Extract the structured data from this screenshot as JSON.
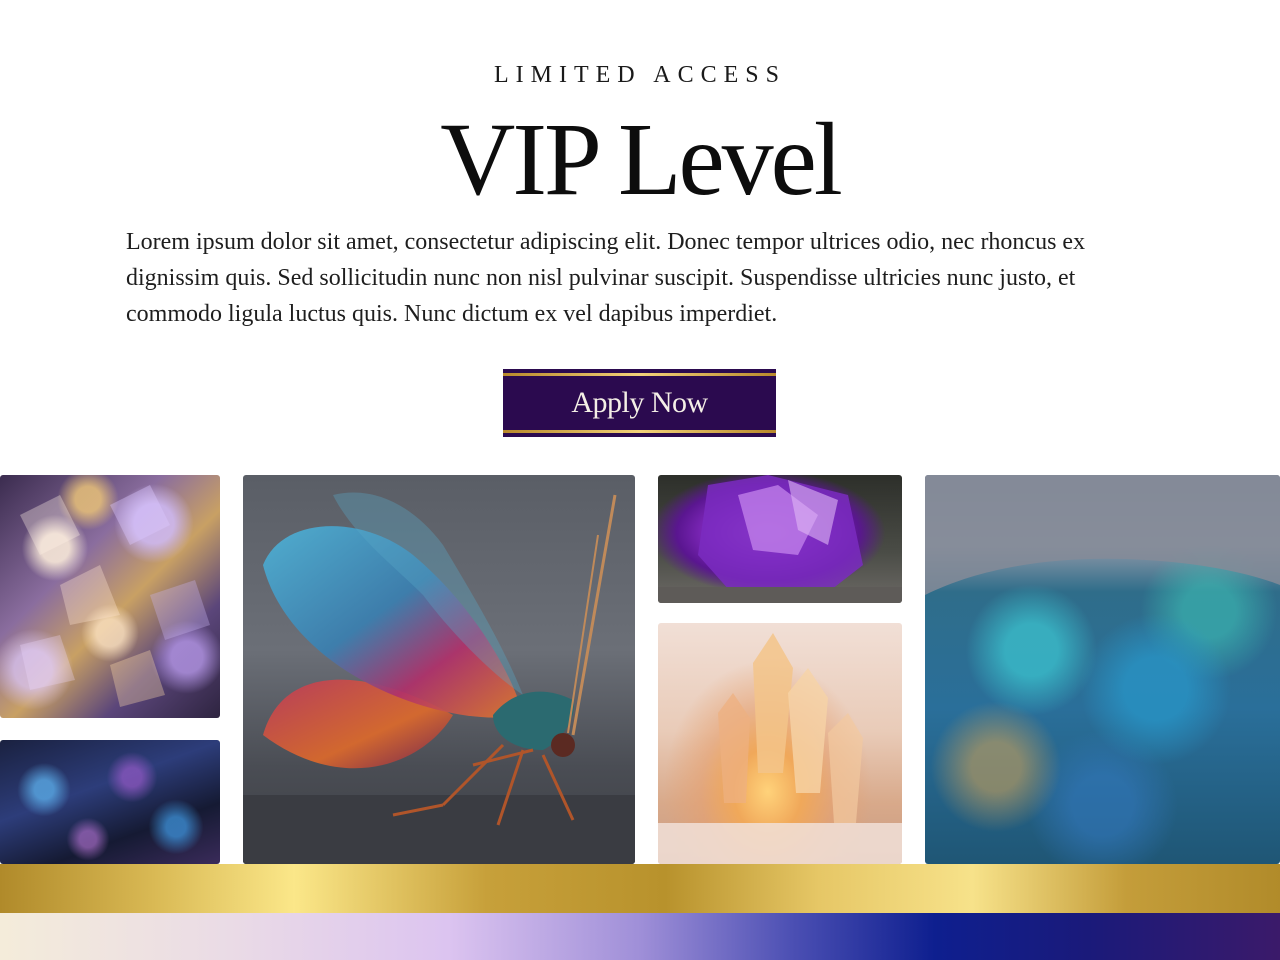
{
  "hero": {
    "eyebrow": "LIMITED ACCESS",
    "title": "VIP Level",
    "description": "Lorem ipsum dolor sit amet, consectetur adipiscing elit. Donec tempor ultrices odio, nec rhoncus ex dignissim quis. Sed sollicitudin nunc non nisl pulvinar suscipit. Suspendisse ultricies nunc justo, et commodo ligula luctus quis. Nunc dictum ex vel dapibus imperdiet.",
    "cta_label": "Apply Now"
  },
  "gallery": {
    "images": [
      {
        "subject": "iridescent crystal shards"
      },
      {
        "subject": "blue mineral rock"
      },
      {
        "subject": "iridescent winged insect"
      },
      {
        "subject": "amethyst crystal"
      },
      {
        "subject": "quartz crystal cluster"
      },
      {
        "subject": "blue peacock ore"
      }
    ]
  },
  "colors": {
    "cta_background": "#2b0a4f",
    "cta_border": "#d4ac4c",
    "gold_band": "#e6c766",
    "gradient_band_start": "#f4ecda",
    "gradient_band_end": "#3b1a6a"
  }
}
